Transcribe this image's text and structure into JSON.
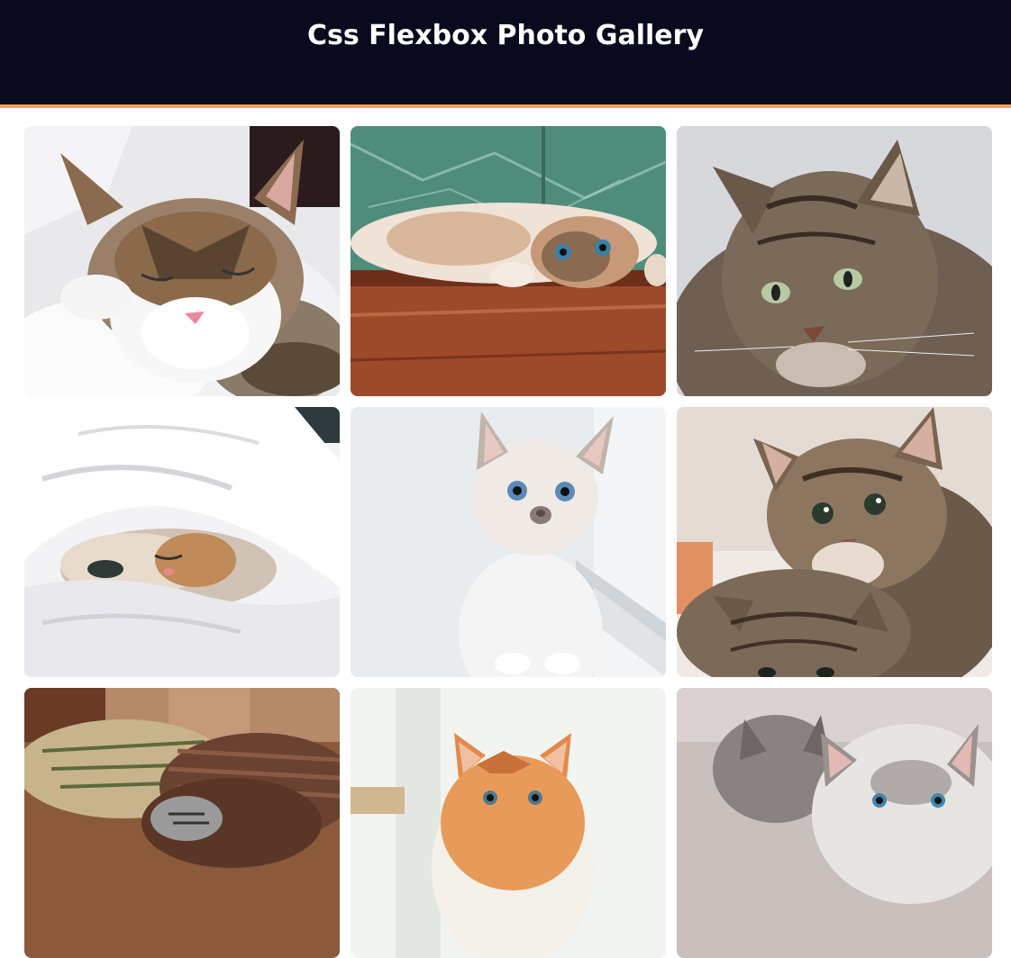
{
  "header": {
    "title": "Css Flexbox Photo Gallery",
    "background": "#0a0a1f",
    "accent": "#f2a54a"
  },
  "gallery": {
    "photos": [
      {
        "subject": "sleeping-tabby-white-cat-photo"
      },
      {
        "subject": "kitten-lying-on-wood-floor-photo"
      },
      {
        "subject": "grey-tabby-cat-portrait-photo"
      },
      {
        "subject": "cat-under-white-duvet-photo"
      },
      {
        "subject": "white-siamese-kitten-photo"
      },
      {
        "subject": "two-tabby-kittens-photo"
      },
      {
        "subject": "kitten-under-fluffy-blanket-photo"
      },
      {
        "subject": "orange-kitten-photo"
      },
      {
        "subject": "grey-white-kittens-photo"
      }
    ]
  }
}
